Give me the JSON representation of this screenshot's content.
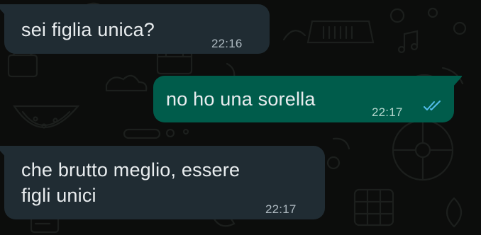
{
  "messages": [
    {
      "direction": "incoming",
      "text": "sei figlia unica?",
      "time": "22:16"
    },
    {
      "direction": "outgoing",
      "text": "no ho una sorella",
      "time": "22:17",
      "status": "read"
    },
    {
      "direction": "incoming",
      "lines": [
        "che brutto meglio, essere",
        "figli unici"
      ],
      "time": "22:17"
    }
  ],
  "colors": {
    "background": "#0c0d0c",
    "incoming_bubble": "#202c33",
    "outgoing_bubble": "#005c4b",
    "read_ticks": "#53bdeb",
    "text": "#e9edef"
  },
  "icons": [
    "double-check-icon",
    "wallpaper-doodles"
  ]
}
